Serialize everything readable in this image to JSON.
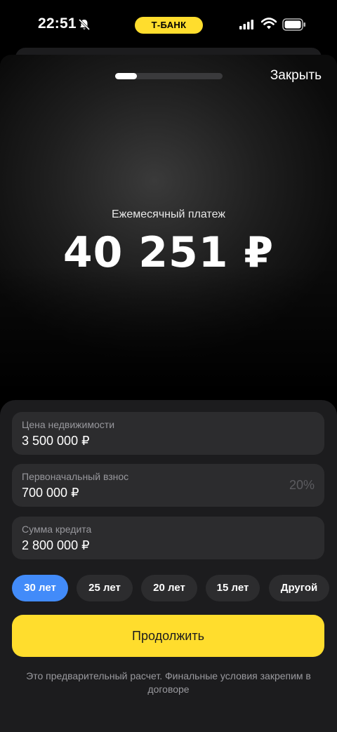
{
  "status_bar": {
    "time": "22:51",
    "bank_badge": "Т-БАНК"
  },
  "header": {
    "close_label": "Закрыть",
    "progress_fraction": 0.2
  },
  "payment": {
    "label": "Ежемесячный платеж",
    "amount": "40 251 ₽"
  },
  "fields": [
    {
      "label": "Цена недвижимости",
      "value": "3 500 000 ₽"
    },
    {
      "label": "Первоначальный взнос",
      "value": "700 000 ₽",
      "percent": "20%"
    },
    {
      "label": "Сумма кредита",
      "value": "2 800 000 ₽"
    }
  ],
  "terms": [
    {
      "label": "30 лет",
      "selected": true
    },
    {
      "label": "25 лет",
      "selected": false
    },
    {
      "label": "20 лет",
      "selected": false
    },
    {
      "label": "15 лет",
      "selected": false
    },
    {
      "label": "Другой",
      "selected": false
    }
  ],
  "continue_label": "Продолжить",
  "disclaimer": "Это предварительный расчет. Финальные условия закрепим в договоре",
  "colors": {
    "accent_yellow": "#ffdd2d",
    "selected_chip": "#428bf9",
    "panel": "#1c1c1e",
    "field": "#2c2c2e"
  }
}
